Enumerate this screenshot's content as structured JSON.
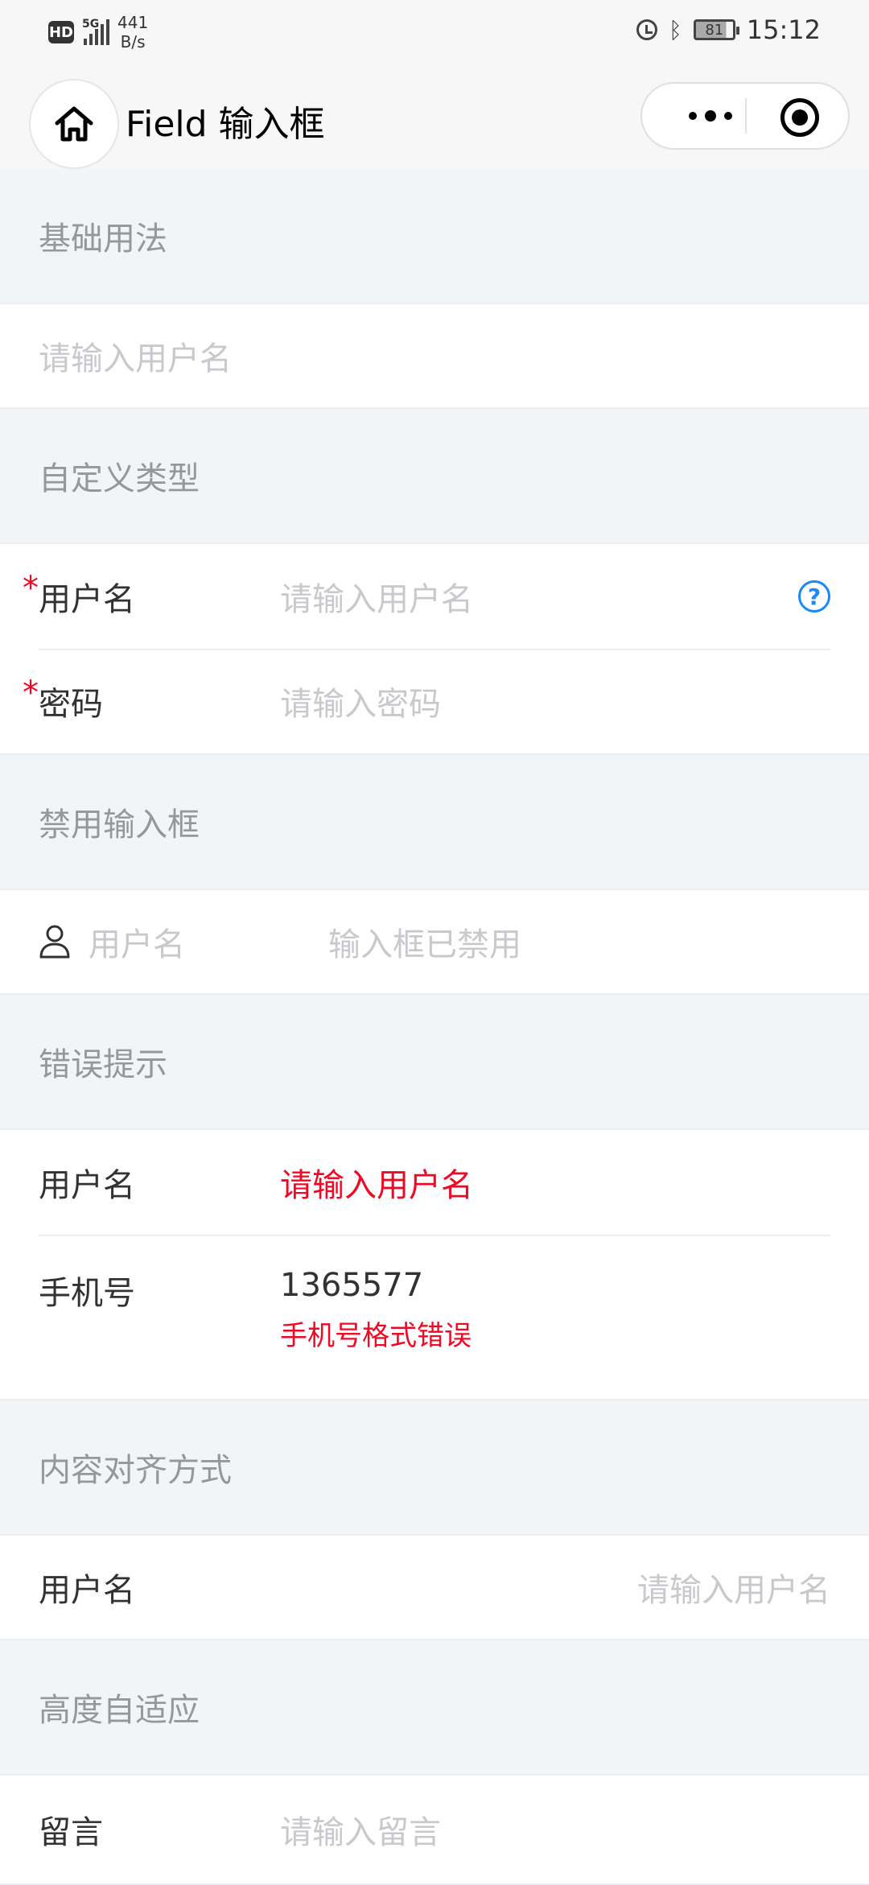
{
  "status_bar": {
    "hd": "HD",
    "network": "5G",
    "net_speed_value": "441",
    "net_speed_unit": "B/s",
    "battery": "81",
    "time": "15:12"
  },
  "navbar": {
    "title": "Field 输入框"
  },
  "sections": {
    "basic": {
      "title": "基础用法",
      "placeholder": "请输入用户名"
    },
    "custom": {
      "title": "自定义类型",
      "username_label": "用户名",
      "username_placeholder": "请输入用户名",
      "password_label": "密码",
      "password_placeholder": "请输入密码"
    },
    "disabled": {
      "title": "禁用输入框",
      "label": "用户名",
      "value": "输入框已禁用"
    },
    "error": {
      "title": "错误提示",
      "username_label": "用户名",
      "username_placeholder": "请输入用户名",
      "phone_label": "手机号",
      "phone_value": "1365577",
      "phone_error": "手机号格式错误"
    },
    "align": {
      "title": "内容对齐方式",
      "label": "用户名",
      "placeholder": "请输入用户名"
    },
    "autosize": {
      "title": "高度自适应",
      "label": "留言",
      "placeholder": "请输入留言"
    }
  },
  "colors": {
    "required": "#ee0a24",
    "error": "#ee0a24",
    "help_icon": "#1989fa",
    "placeholder": "#c8c9cc"
  }
}
